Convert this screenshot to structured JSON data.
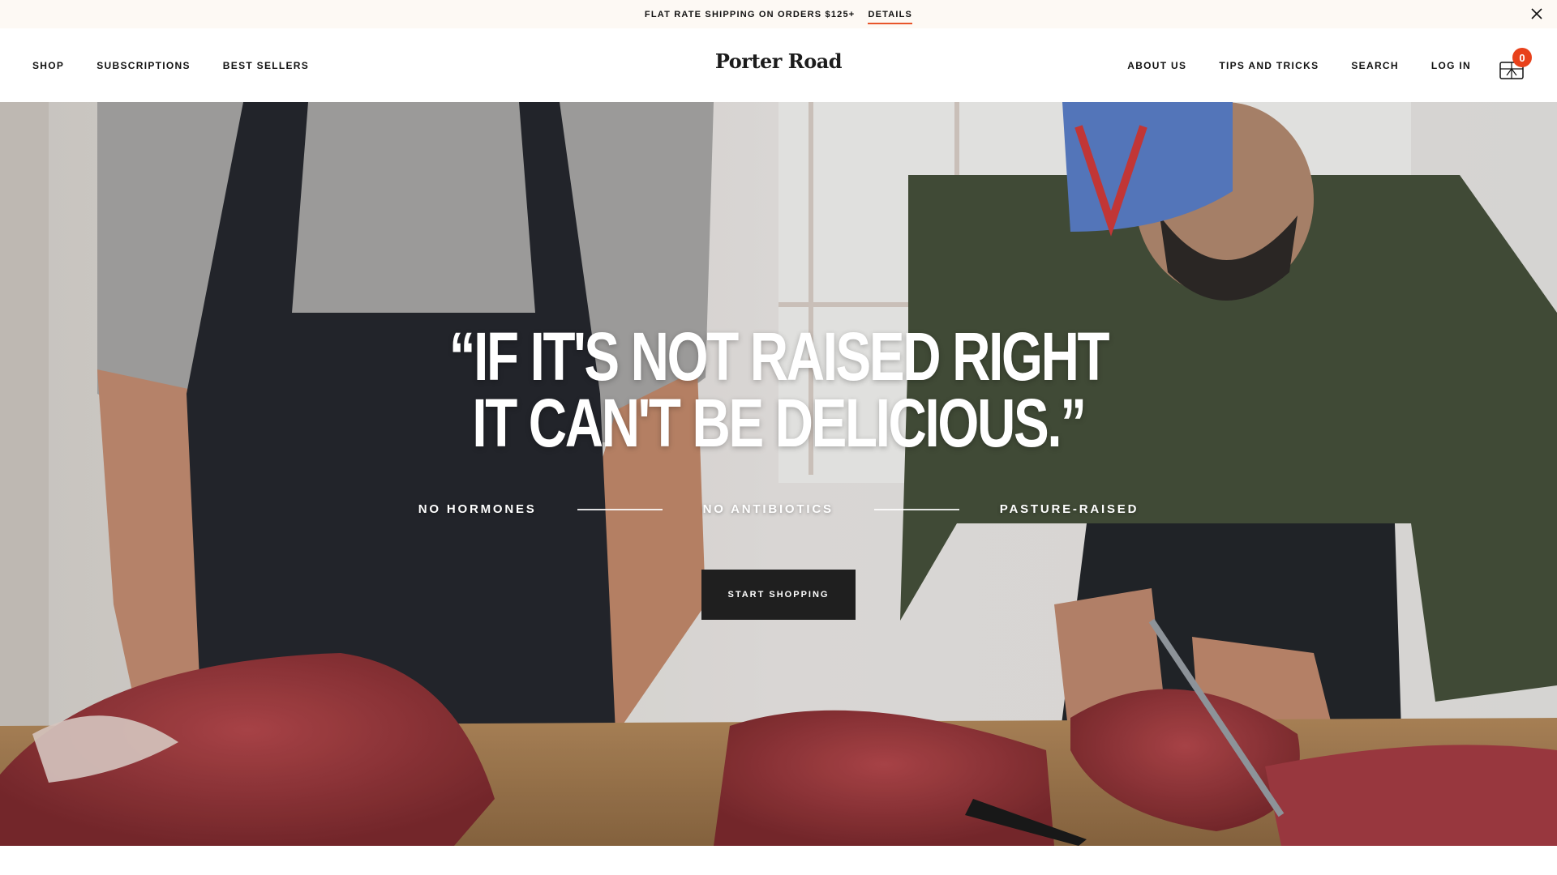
{
  "promo": {
    "text": "FLAT RATE SHIPPING ON ORDERS $125+",
    "link": "DETAILS"
  },
  "header": {
    "logo": "Porter Road",
    "nav_left": [
      "SHOP",
      "SUBSCRIPTIONS",
      "BEST SELLERS"
    ],
    "nav_right": [
      "ABOUT US",
      "TIPS AND TRICKS",
      "SEARCH",
      "LOG IN"
    ],
    "cart_count": "0",
    "cart_icon": "shopping-cart-icon"
  },
  "hero": {
    "quote_line1": "“IF IT'S NOT RAISED RIGHT",
    "quote_line2": "IT CAN'T BE DELICIOUS.”",
    "features": [
      "NO HORMONES",
      "NO ANTIBIOTICS",
      "PASTURE-RAISED"
    ],
    "cta": "START SHOPPING"
  },
  "colors": {
    "accent": "#e8411b",
    "promo_bg": "#fdf9f4",
    "cta_bg": "#1f1f1f"
  }
}
